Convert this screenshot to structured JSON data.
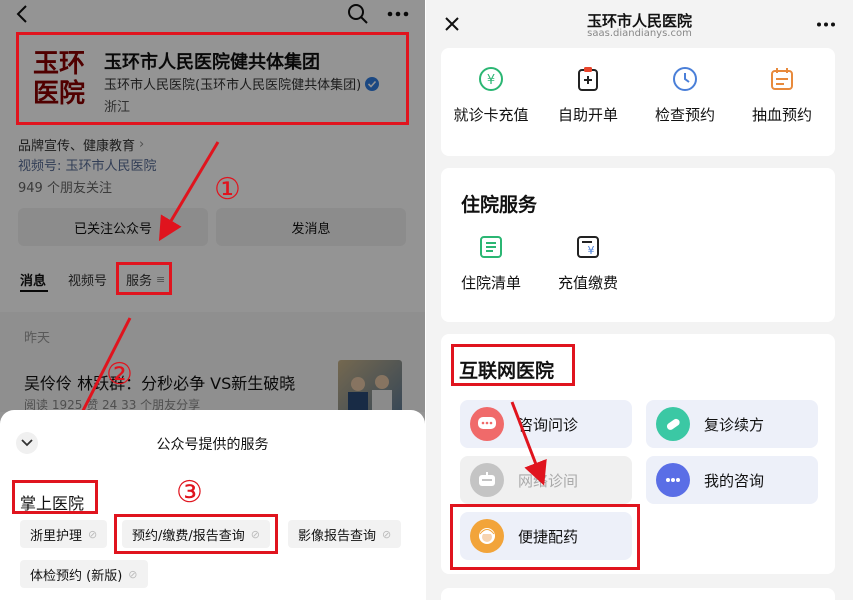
{
  "left": {
    "profile": {
      "logo_text": "玉环医院",
      "name": "玉环市人民医院健共体集团",
      "subtitle": "玉环市人民医院(玉环市人民医院健共体集团)",
      "region": "浙江"
    },
    "info": {
      "category": "品牌宣传、健康教育",
      "video_account": "视频号: 玉环市人民医院",
      "followers": "949 个朋友关注"
    },
    "buttons": {
      "followed": "已关注公众号",
      "message": "发消息"
    },
    "tabs": [
      {
        "label": "消息"
      },
      {
        "label": "视频号"
      },
      {
        "label": "服务"
      }
    ],
    "feed": {
      "date": "昨天",
      "title": "吴伶伶 林跃群：分秒必争 VS新生破晓",
      "meta": "阅读 1925  赞 24  33 个朋友分享"
    },
    "sheet": {
      "title": "公众号提供的服务",
      "section": "掌上医院",
      "chips": [
        "浙里护理",
        "预约/缴费/报告查询",
        "影像报告查询",
        "体检预约 (新版)"
      ]
    },
    "annotations": [
      "①",
      "②",
      "③"
    ]
  },
  "right": {
    "header": {
      "title": "玉环市人民医院",
      "url": "saas.diandianys.com"
    },
    "top_services": [
      "就诊卡充值",
      "自助开单",
      "检查预约",
      "抽血预约"
    ],
    "inpatient": {
      "title": "住院服务",
      "items": [
        "住院清单",
        "充值缴费"
      ]
    },
    "internet": {
      "title": "互联网医院",
      "tiles": [
        "咨询问诊",
        "复诊续方",
        "网络诊间",
        "我的咨询",
        "便捷配药"
      ]
    }
  },
  "colors": {
    "annotation_red": "#e0141e",
    "accent_green": "#1aad19",
    "link_blue": "#576b95"
  }
}
